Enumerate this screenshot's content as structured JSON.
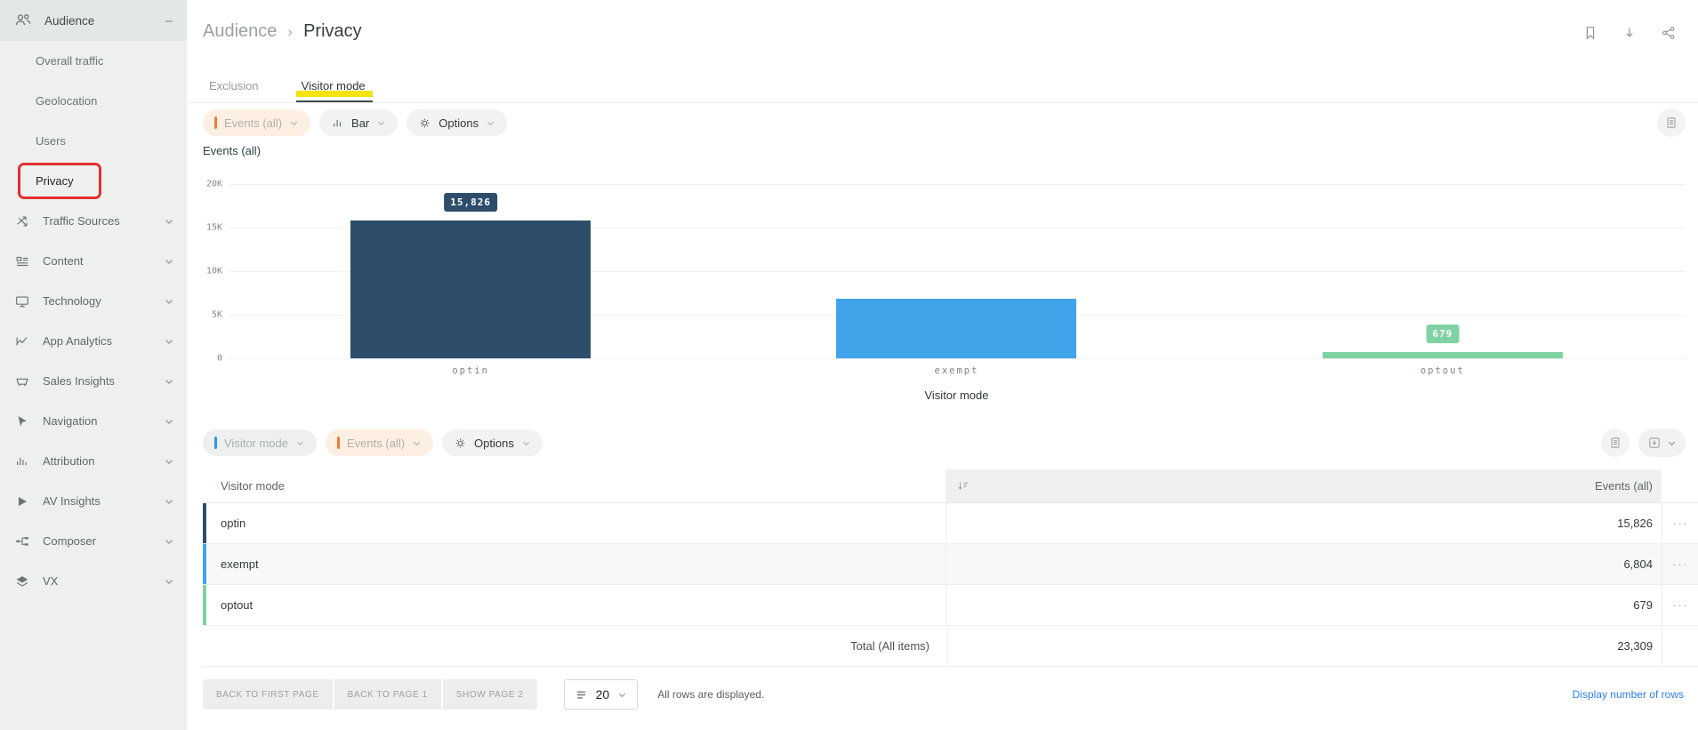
{
  "sidebar": {
    "items": [
      {
        "label": "Audience",
        "icon": "people-icon",
        "expanded": true
      },
      {
        "label": "Traffic Sources",
        "icon": "traffic-sources-icon"
      },
      {
        "label": "Content",
        "icon": "content-icon"
      },
      {
        "label": "Technology",
        "icon": "technology-icon"
      },
      {
        "label": "App Analytics",
        "icon": "app-analytics-icon"
      },
      {
        "label": "Sales Insights",
        "icon": "sales-insights-icon"
      },
      {
        "label": "Navigation",
        "icon": "navigation-icon"
      },
      {
        "label": "Attribution",
        "icon": "attribution-icon"
      },
      {
        "label": "AV Insights",
        "icon": "av-insights-icon"
      },
      {
        "label": "Composer",
        "icon": "composer-icon"
      },
      {
        "label": "VX",
        "icon": "vx-icon"
      }
    ],
    "audience_children": [
      "Overall traffic",
      "Geolocation",
      "Users",
      "Privacy"
    ],
    "collapse_glyph": "–"
  },
  "header": {
    "breadcrumb_parent": "Audience",
    "separator": "›",
    "breadcrumb_current": "Privacy"
  },
  "tabs": [
    {
      "label": "Exclusion",
      "active": false
    },
    {
      "label": "Visitor mode",
      "active": true
    }
  ],
  "chart_controls": {
    "metric_label": "Events (all)",
    "chart_type_label": "Bar",
    "options_label": "Options"
  },
  "chart_data": {
    "type": "bar",
    "title": "Events (all)",
    "categories": [
      "optin",
      "exempt",
      "optout"
    ],
    "values": [
      15826,
      6804,
      679
    ],
    "value_labels": [
      "15,826",
      "",
      "679"
    ],
    "bar_colors": [
      "#2e4d6b",
      "#41a4eb",
      "#7fd3a2"
    ],
    "xlabel": "Visitor mode",
    "ylabel": "Events (all)",
    "ylim": [
      0,
      20000
    ],
    "yticks": [
      "20K",
      "15K",
      "10K",
      "5K",
      "0"
    ],
    "grid": true,
    "legend": false
  },
  "table_controls": {
    "dimension_label": "Visitor mode",
    "metric_label": "Events (all)",
    "options_label": "Options"
  },
  "table": {
    "columns": [
      "Visitor mode",
      "Events (all)"
    ],
    "rows": [
      {
        "label": "optin",
        "value": "15,826"
      },
      {
        "label": "exempt",
        "value": "6,804"
      },
      {
        "label": "optout",
        "value": "679"
      }
    ],
    "total_label": "Total (All items)",
    "total_value": "23,309",
    "more_glyph": "···"
  },
  "pagination": {
    "buttons": [
      "BACK TO FIRST PAGE",
      "BACK TO PAGE 1",
      "SHOW PAGE 2"
    ],
    "rows_per_page": "20",
    "status": "All rows are displayed.",
    "link": "Display number of rows"
  },
  "colors": {
    "optin": "#2e4d6b",
    "exempt": "#41a4eb",
    "optout": "#7fd3a2",
    "metric_accent": "#ef7c38",
    "dimension_accent": "#3095e8",
    "annotation_red": "#e0312f",
    "annotation_yellow": "#f4e30f",
    "link_blue": "#2f7ef0"
  }
}
